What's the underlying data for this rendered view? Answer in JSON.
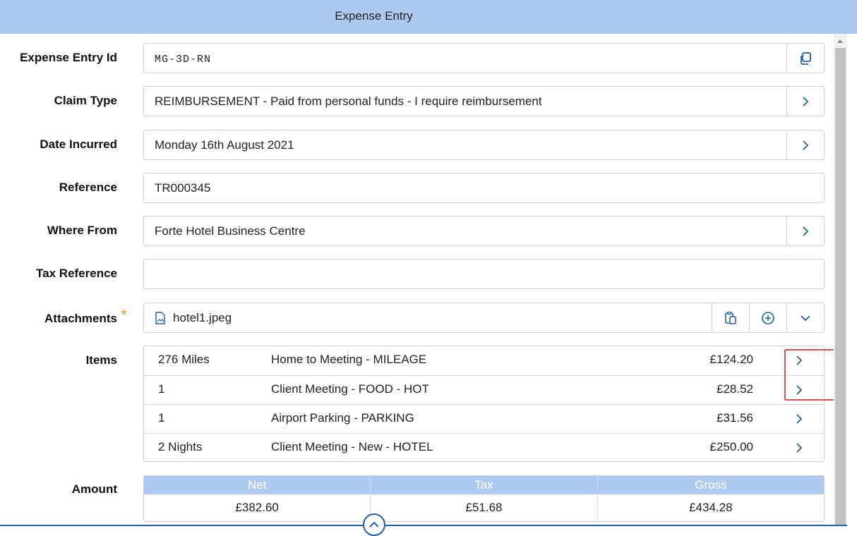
{
  "header": {
    "title": "Expense Entry"
  },
  "fields": {
    "expense_entry_id": {
      "label": "Expense Entry Id",
      "value": "MG-3D-RN"
    },
    "claim_type": {
      "label": "Claim Type",
      "value": "REIMBURSEMENT - Paid from personal funds - I require reimbursement"
    },
    "date_incurred": {
      "label": "Date Incurred",
      "value": "Monday 16th August 2021"
    },
    "reference": {
      "label": "Reference",
      "value": "TR000345"
    },
    "where_from": {
      "label": "Where From",
      "value": "Forte Hotel Business Centre"
    },
    "tax_reference": {
      "label": "Tax Reference",
      "value": ""
    },
    "attachments": {
      "label": "Attachments",
      "required_marker": "*",
      "file": "hotel1.jpeg"
    }
  },
  "items": {
    "label": "Items",
    "rows": [
      {
        "qty": "276 Miles",
        "desc": "Home to Meeting - MILEAGE",
        "amount": "£124.20"
      },
      {
        "qty": "1",
        "desc": "Client Meeting - FOOD - HOT",
        "amount": "£28.52"
      },
      {
        "qty": "1",
        "desc": "Airport Parking - PARKING",
        "amount": "£31.56"
      },
      {
        "qty": "2 Nights",
        "desc": "Client Meeting - New - HOTEL",
        "amount": "£250.00"
      }
    ]
  },
  "amount": {
    "label": "Amount",
    "headers": [
      "Net",
      "Tax",
      "Gross"
    ],
    "values": [
      "£382.60",
      "£51.68",
      "£434.28"
    ]
  },
  "colors": {
    "header_bg": "#afcaf0",
    "accent": "#1f5fb0",
    "required": "#f0a020",
    "highlight": "#e05050"
  },
  "icons": {
    "copy": "copy-icon",
    "chevron_right": "chevron-right-icon",
    "chevron_down": "chevron-down-icon",
    "chevron_up": "chevron-up-icon",
    "paste": "paste-icon",
    "add": "add-circle-icon",
    "file_image": "image-file-icon"
  }
}
